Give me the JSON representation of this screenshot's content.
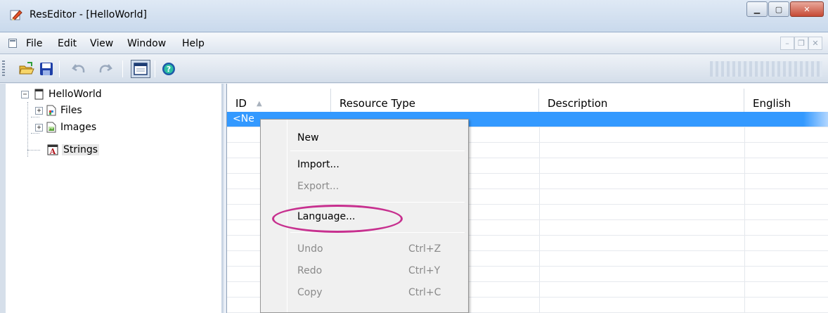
{
  "window": {
    "title": "ResEditor - [HelloWorld]"
  },
  "menubar": {
    "items": [
      "File",
      "Edit",
      "View",
      "Window",
      "Help"
    ]
  },
  "toolbar": {
    "buttons": [
      "open-icon",
      "save-icon",
      "undo-icon",
      "redo-icon",
      "grid-view-icon",
      "help-icon"
    ]
  },
  "tree": {
    "root": "HelloWorld",
    "children": [
      "Files",
      "Images",
      "Strings"
    ]
  },
  "grid": {
    "columns": [
      "ID",
      "Resource Type",
      "Description",
      "English"
    ],
    "sort_indicator": "▲",
    "rows": [
      {
        "id": "<Ne"
      }
    ]
  },
  "context_menu": {
    "items": [
      {
        "label": "New"
      },
      {
        "label": "Import..."
      },
      {
        "label": "Export..."
      },
      {
        "label": "Language..."
      },
      {
        "label": "Undo",
        "shortcut": "Ctrl+Z"
      },
      {
        "label": "Redo",
        "shortcut": "Ctrl+Y"
      },
      {
        "label": "Copy",
        "shortcut": "Ctrl+C"
      }
    ]
  },
  "colors": {
    "selection": "#3399ff",
    "highlight_ring": "#c7308f"
  }
}
